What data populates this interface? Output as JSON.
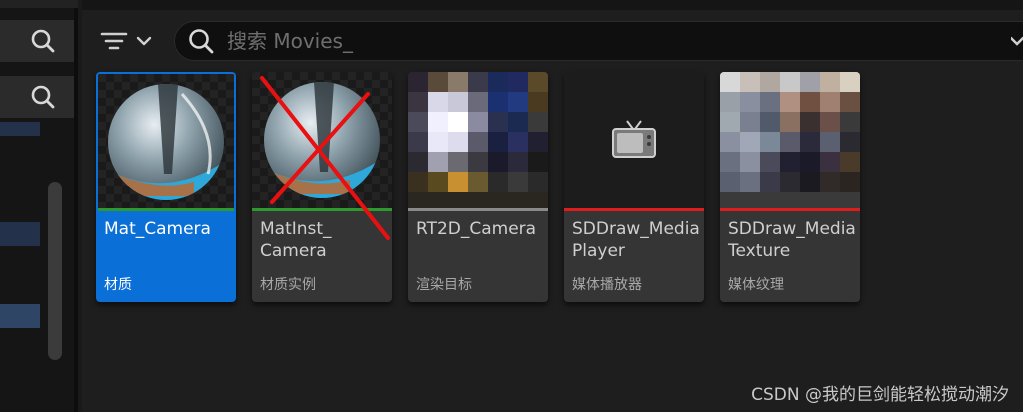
{
  "search": {
    "placeholder": "搜索 Movies_"
  },
  "icons": {
    "left_search_1": "search-icon",
    "left_search_2": "search-icon",
    "filter": "filter-icon",
    "dropdown": "chevron-down-icon",
    "search": "search-icon",
    "tv": "tv-icon"
  },
  "assets": [
    {
      "name": "Mat_Camera",
      "type": "材质",
      "bar_color": "#2e9a2e",
      "selected": true,
      "crossed": false
    },
    {
      "name": "MatInst_\nCamera",
      "type": "材质实例",
      "bar_color": "#2e9a2e",
      "selected": false,
      "crossed": true
    },
    {
      "name": "RT2D_Camera",
      "type": "渲染目标",
      "bar_color": "#8a8a8a",
      "selected": false,
      "crossed": false
    },
    {
      "name": "SDDraw_Media\nPlayer",
      "type": "媒体播放器",
      "bar_color": "#e01b1b",
      "selected": false,
      "crossed": false
    },
    {
      "name": "SDDraw_Media\nTexture",
      "type": "媒体纹理",
      "bar_color": "#e01b1b",
      "selected": false,
      "crossed": false
    }
  ],
  "watermark": "CSDN @我的巨剑能轻松搅动潮汐",
  "colors": {
    "accent": "#0a6fd6",
    "background": "#1e1e1e",
    "tile": "#353535"
  }
}
